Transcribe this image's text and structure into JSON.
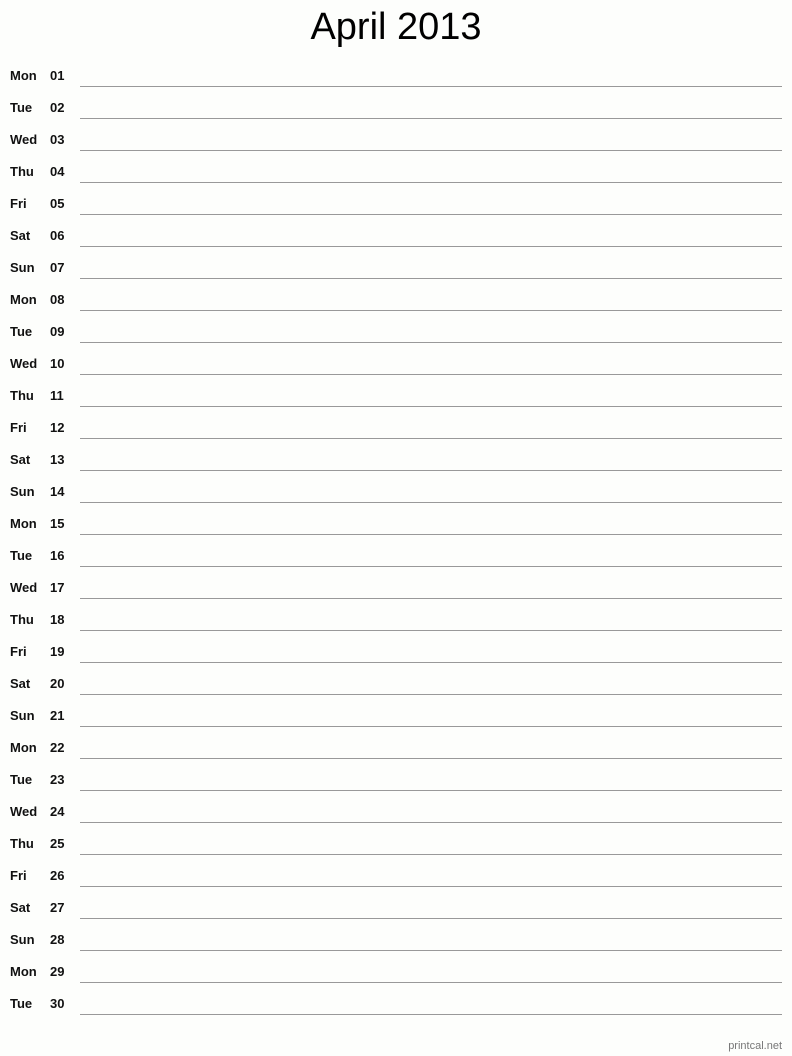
{
  "title": "April 2013",
  "days": [
    {
      "dow": "Mon",
      "num": "01"
    },
    {
      "dow": "Tue",
      "num": "02"
    },
    {
      "dow": "Wed",
      "num": "03"
    },
    {
      "dow": "Thu",
      "num": "04"
    },
    {
      "dow": "Fri",
      "num": "05"
    },
    {
      "dow": "Sat",
      "num": "06"
    },
    {
      "dow": "Sun",
      "num": "07"
    },
    {
      "dow": "Mon",
      "num": "08"
    },
    {
      "dow": "Tue",
      "num": "09"
    },
    {
      "dow": "Wed",
      "num": "10"
    },
    {
      "dow": "Thu",
      "num": "11"
    },
    {
      "dow": "Fri",
      "num": "12"
    },
    {
      "dow": "Sat",
      "num": "13"
    },
    {
      "dow": "Sun",
      "num": "14"
    },
    {
      "dow": "Mon",
      "num": "15"
    },
    {
      "dow": "Tue",
      "num": "16"
    },
    {
      "dow": "Wed",
      "num": "17"
    },
    {
      "dow": "Thu",
      "num": "18"
    },
    {
      "dow": "Fri",
      "num": "19"
    },
    {
      "dow": "Sat",
      "num": "20"
    },
    {
      "dow": "Sun",
      "num": "21"
    },
    {
      "dow": "Mon",
      "num": "22"
    },
    {
      "dow": "Tue",
      "num": "23"
    },
    {
      "dow": "Wed",
      "num": "24"
    },
    {
      "dow": "Thu",
      "num": "25"
    },
    {
      "dow": "Fri",
      "num": "26"
    },
    {
      "dow": "Sat",
      "num": "27"
    },
    {
      "dow": "Sun",
      "num": "28"
    },
    {
      "dow": "Mon",
      "num": "29"
    },
    {
      "dow": "Tue",
      "num": "30"
    }
  ],
  "footer": "printcal.net"
}
